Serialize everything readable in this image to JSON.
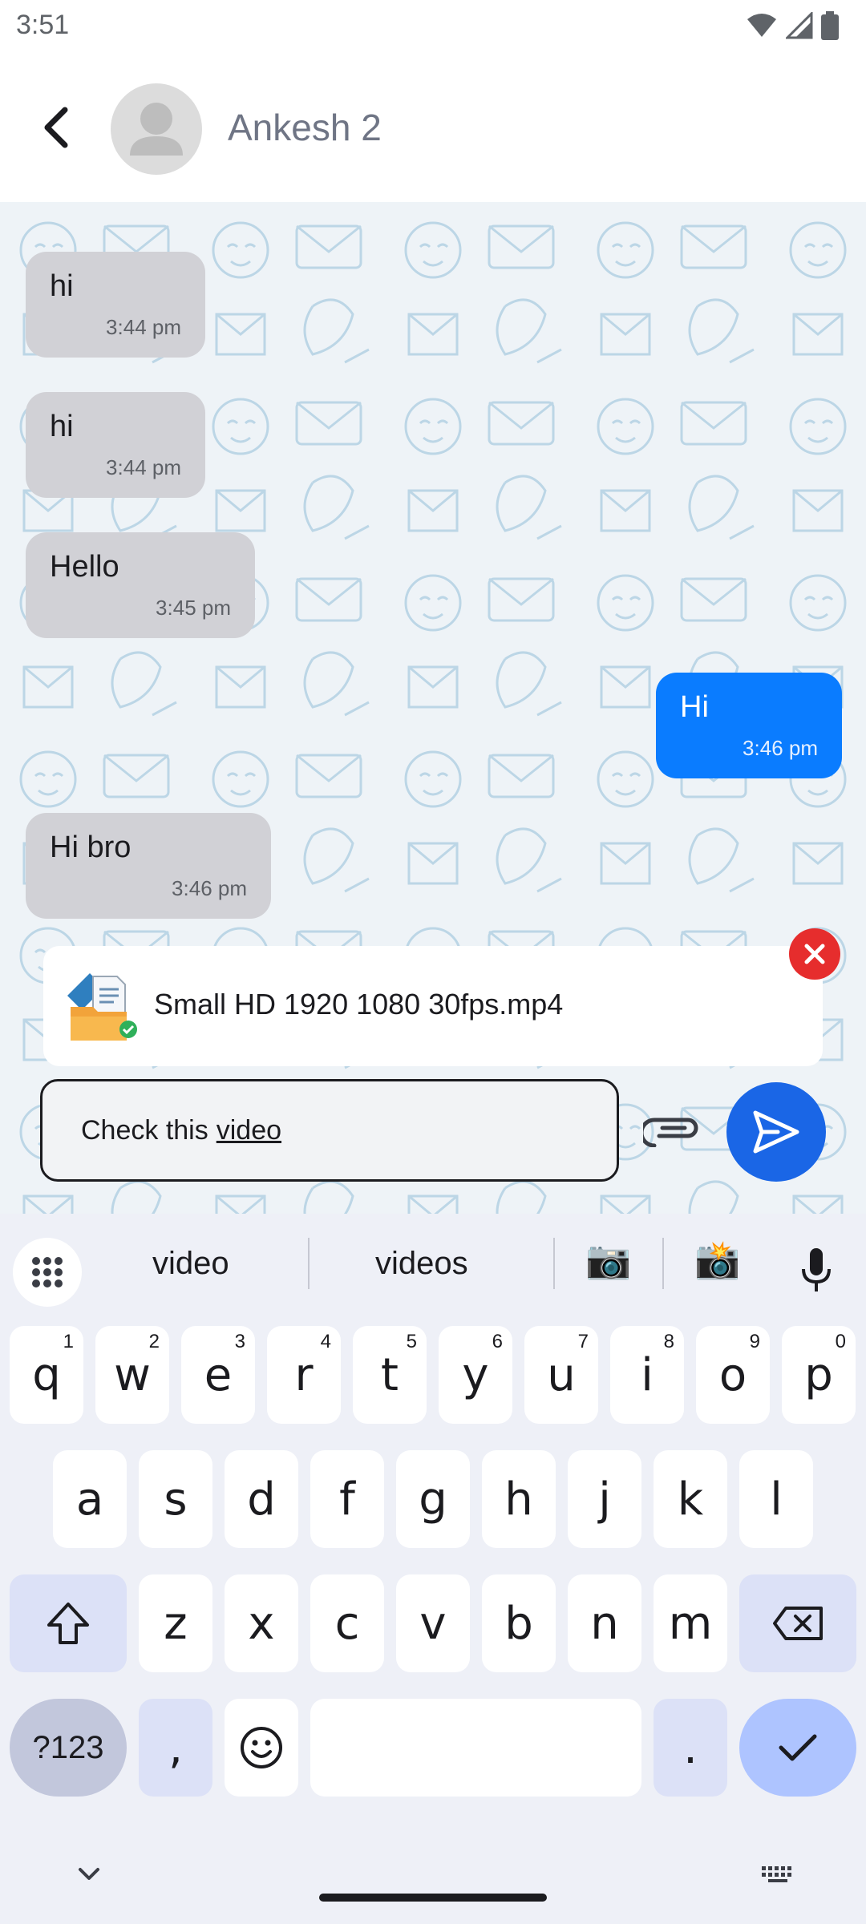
{
  "status_bar": {
    "time": "3:51",
    "icons": [
      "wifi-icon",
      "signal-icon",
      "battery-icon"
    ]
  },
  "header": {
    "contact_name": "Ankesh 2"
  },
  "messages": [
    {
      "direction": "in",
      "text": "hi",
      "time": "3:44 pm"
    },
    {
      "direction": "in",
      "text": "hi",
      "time": "3:44 pm"
    },
    {
      "direction": "in",
      "text": "Hello",
      "time": "3:45 pm"
    },
    {
      "direction": "out",
      "text": "Hi",
      "time": "3:46 pm"
    },
    {
      "direction": "in",
      "text": "Hi bro",
      "time": "3:46 pm"
    }
  ],
  "attachment": {
    "file_name": "Small HD 1920 1080 30fps.mp4"
  },
  "composer": {
    "text_prefix": "Check this",
    "text_current_word": "video"
  },
  "keyboard": {
    "suggestions": [
      "video",
      "videos"
    ],
    "emoji_suggestions": [
      "📷",
      "📸"
    ],
    "row1": [
      {
        "k": "q",
        "h": "1"
      },
      {
        "k": "w",
        "h": "2"
      },
      {
        "k": "e",
        "h": "3"
      },
      {
        "k": "r",
        "h": "4"
      },
      {
        "k": "t",
        "h": "5"
      },
      {
        "k": "y",
        "h": "6"
      },
      {
        "k": "u",
        "h": "7"
      },
      {
        "k": "i",
        "h": "8"
      },
      {
        "k": "o",
        "h": "9"
      },
      {
        "k": "p",
        "h": "0"
      }
    ],
    "row2": [
      "a",
      "s",
      "d",
      "f",
      "g",
      "h",
      "j",
      "k",
      "l"
    ],
    "row3": [
      "z",
      "x",
      "c",
      "v",
      "b",
      "n",
      "m"
    ],
    "symbols_label": "?123",
    "comma": ",",
    "period": "."
  },
  "colors": {
    "incoming_bubble": "#d1d1d6",
    "outgoing_bubble": "#0a7cff",
    "send_button": "#1a66e6",
    "remove_button": "#e62d2d",
    "chat_background": "#eef3f7"
  }
}
